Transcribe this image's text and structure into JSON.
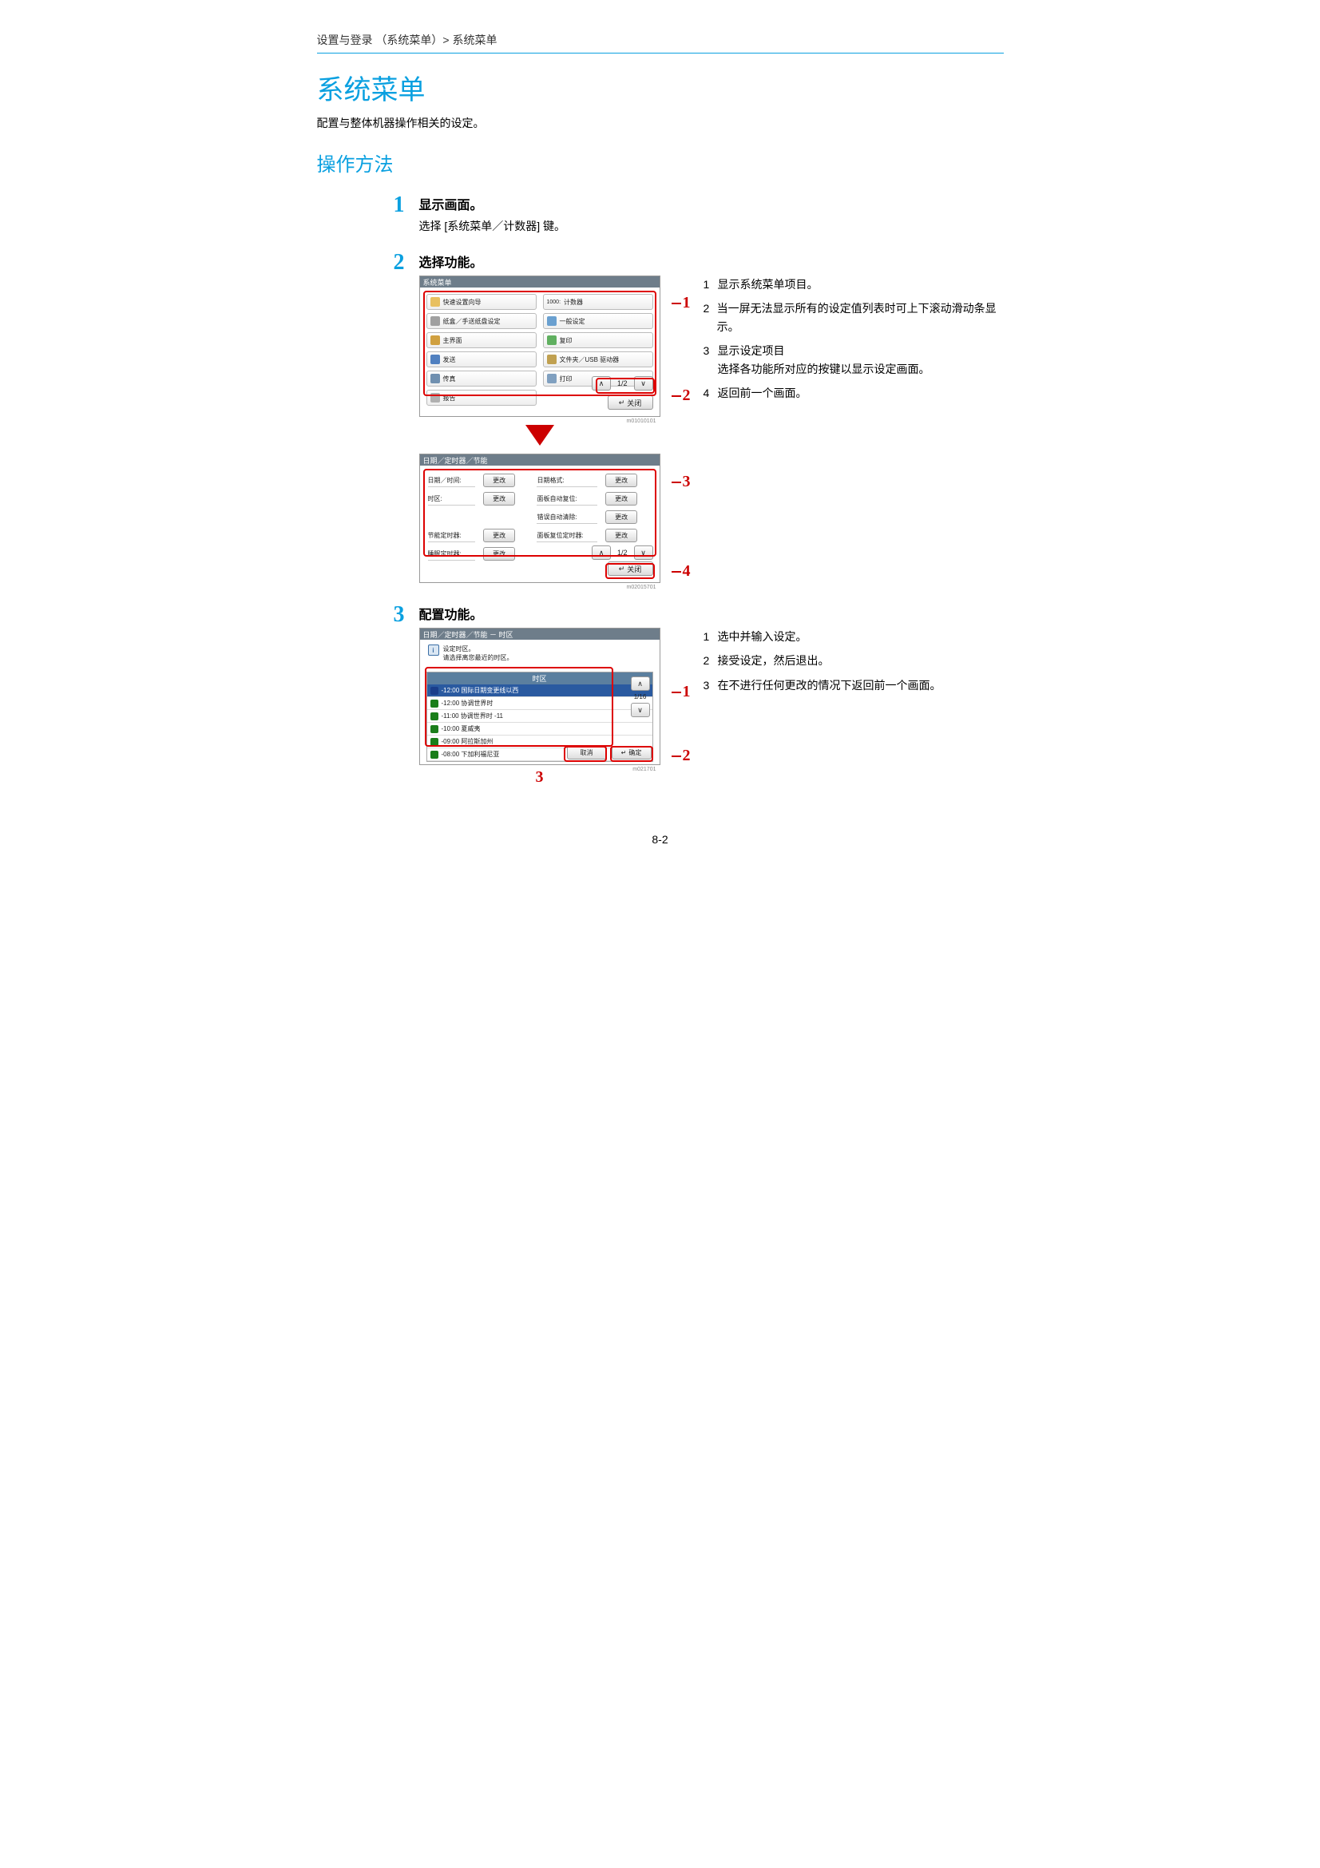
{
  "breadcrumb": "设置与登录 （系统菜单）> 系统菜单",
  "h1": "系统菜单",
  "intro": "配置与整体机器操作相关的设定。",
  "h2": "操作方法",
  "steps": {
    "s1": {
      "num": "1",
      "title": "显示画面。",
      "sub": "选择 [系统菜单／计数器] 键。"
    },
    "s2": {
      "num": "2",
      "title": "选择功能。"
    },
    "s3": {
      "num": "3",
      "title": "配置功能。"
    }
  },
  "screen1": {
    "title": "系统菜单",
    "items_left": [
      "快速设置向导",
      "纸盒／手送纸盘设定",
      "主界面",
      "发送",
      "传真",
      "报告"
    ],
    "items_right_labels": [
      "计数器",
      "一般设定",
      "复印",
      "文件夹／USB 驱动器",
      "打印"
    ],
    "items_right_prefix": "",
    "pager": "1/2",
    "close": "关闭",
    "code": "m01010101"
  },
  "screen2": {
    "title": "日期／定时器／节能",
    "left_labels": [
      "日期／时间:",
      "时区:",
      "节能定时器:",
      "睡眠定时器:"
    ],
    "right_labels": [
      "日期格式:",
      "面板自动复位:",
      "错误自动清除:",
      "面板复位定时器:"
    ],
    "change": "更改",
    "pager": "1/2",
    "close": "关闭",
    "code": "m02015701"
  },
  "screen3": {
    "title": "日期／定时器／节能 － 时区",
    "hint1": "设定时区。",
    "hint2": "请选择离您最近的时区。",
    "header": "时区",
    "rows": [
      "-12:00 国际日期变更线以西",
      "-12:00 协调世界时",
      "-11:00 协调世界时 -11",
      "-10:00 夏威夷",
      "-09:00 阿拉斯加州",
      "-08:00 下加利福尼亚"
    ],
    "pager": "1/16",
    "cancel": "取消",
    "ok": "确定",
    "code": "m021701"
  },
  "callouts2": {
    "c1": "1",
    "c2": "2",
    "c3": "3",
    "c4": "4"
  },
  "callouts3": {
    "c1": "1",
    "c2": "2",
    "c3": "3"
  },
  "notes2": {
    "n1": {
      "n": "1",
      "t": "显示系统菜单项目。"
    },
    "n2": {
      "n": "2",
      "t": "当一屏无法显示所有的设定值列表时可上下滚动滑动条显示。"
    },
    "n3": {
      "n": "3",
      "t": "显示设定项目\n选择各功能所对应的按键以显示设定画面。"
    },
    "n4": {
      "n": "4",
      "t": "返回前一个画面。"
    }
  },
  "notes3": {
    "n1": {
      "n": "1",
      "t": "选中并输入设定。"
    },
    "n2": {
      "n": "2",
      "t": "接受设定，然后退出。"
    },
    "n3": {
      "n": "3",
      "t": "在不进行任何更改的情况下返回前一个画面。"
    }
  },
  "footer": "8-2"
}
